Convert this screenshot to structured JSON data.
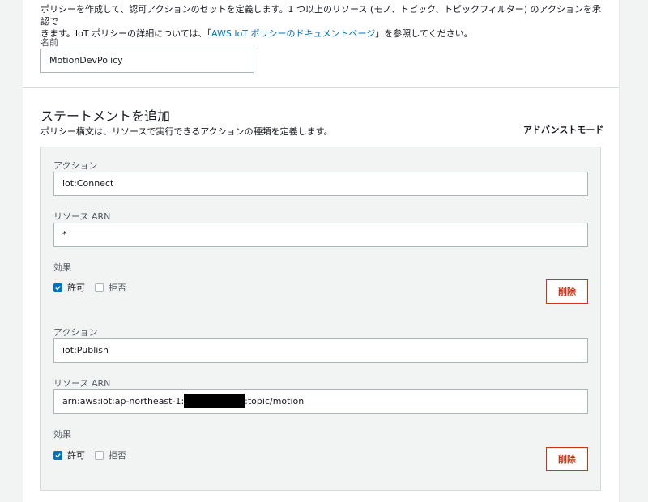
{
  "intro": {
    "line1": "ポリシーを作成して、認可アクションのセットを定義します。1 つ以上のリソース (モノ、トピック、トピックフィルター) のアクションを承認で",
    "line2_prefix": "きます。IoT ポリシーの詳細については、「",
    "link": "AWS IoT ポリシーのドキュメントページ",
    "line2_suffix": "」を参照してください。"
  },
  "name_field": {
    "label": "名前",
    "value": "MotionDevPolicy"
  },
  "statements": {
    "title": "ステートメントを追加",
    "description": "ポリシー構文は、リソースで実行できるアクションの種類を定義します。",
    "advanced_mode": "アドバンストモード",
    "items": [
      {
        "action_label": "アクション",
        "action_value": "iot:Connect",
        "resource_label": "リソース ARN",
        "resource_value": "*",
        "effect_label": "効果",
        "allow_label": "許可",
        "allow_checked": true,
        "deny_label": "拒否",
        "deny_checked": false,
        "delete_label": "削除"
      },
      {
        "action_label": "アクション",
        "action_value": "iot:Publish",
        "resource_label": "リソース ARN",
        "resource_prefix": "arn:aws:iot:ap-northeast-1:",
        "resource_suffix": ":topic/motion",
        "effect_label": "効果",
        "allow_label": "許可",
        "allow_checked": true,
        "deny_label": "拒否",
        "deny_checked": false,
        "delete_label": "削除"
      }
    ]
  },
  "colors": {
    "accent_blue": "#0073bb",
    "danger_red": "#d13212",
    "background": "#f2f3f3"
  }
}
